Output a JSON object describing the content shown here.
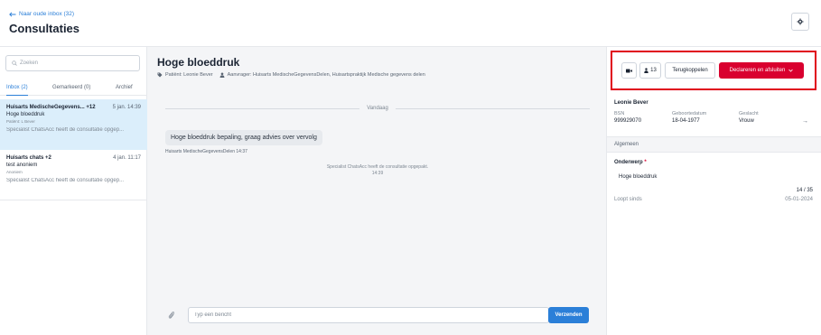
{
  "header": {
    "back_link": "Naar oude inbox (32)",
    "title": "Consultaties",
    "settings_icon": "gear-icon"
  },
  "sidebar": {
    "search_placeholder": "Zoeken",
    "tabs": [
      {
        "label": "Inbox (2)",
        "active": true
      },
      {
        "label": "Gemarkeerd (0)",
        "active": false
      },
      {
        "label": "Archief",
        "active": false
      }
    ],
    "conversations": [
      {
        "title": "Huisarts MedischeGegevens... +12",
        "date": "5 jan. 14:39",
        "subject": "Hoge bloeddruk",
        "patient": "Patiënt: L Bever",
        "preview": "Specialist ChatsAcc heeft de consultatie opgep...",
        "selected": true
      },
      {
        "title": "Huisarts chats +2",
        "date": "4 jan. 11:17",
        "subject": "test anoniem",
        "patient": "Anoniem",
        "preview": "Specialist ChatsAcc heeft de consultatie opgep...",
        "selected": false
      }
    ]
  },
  "conversation": {
    "title": "Hoge bloeddruk",
    "patient": "Patiënt: Leonie Bever",
    "requester": "Aanvrager: Huisarts MedischeGegevensDelen, Huisartspraktijk Medische gegevens delen",
    "day_separator": "Vandaag",
    "message_text": "Hoge bloeddruk bepaling, graag advies over vervolg",
    "message_meta": "Huisarts MedischeGegevensDelen 14:37",
    "system_message": "Specialist ChatsAcc heeft de consultatie opgepakt.",
    "system_time": "14:39",
    "composer_placeholder": "Typ een bericht",
    "send_label": "Verzenden"
  },
  "actions": {
    "participants_count": "13",
    "terug_label": "Terugkoppelen",
    "declare_label": "Declareren en afsluiten",
    "highlight_color": "#e0001b",
    "declare_color": "#d9002f"
  },
  "patient_panel": {
    "name": "Leonie Bever",
    "bsn_label": "BSN",
    "bsn": "999929070",
    "dob_label": "Geboortedatum",
    "dob": "18-04-1977",
    "gender_label": "Geslacht",
    "gender": "Vrouw",
    "section": "Algemeen",
    "subject_label": "Onderwerp",
    "required_mark": "*",
    "subject_value": "Hoge bloeddruk",
    "counter": "14 / 35",
    "since_label": "Loopt sinds",
    "since_value": "05-01-2024"
  }
}
